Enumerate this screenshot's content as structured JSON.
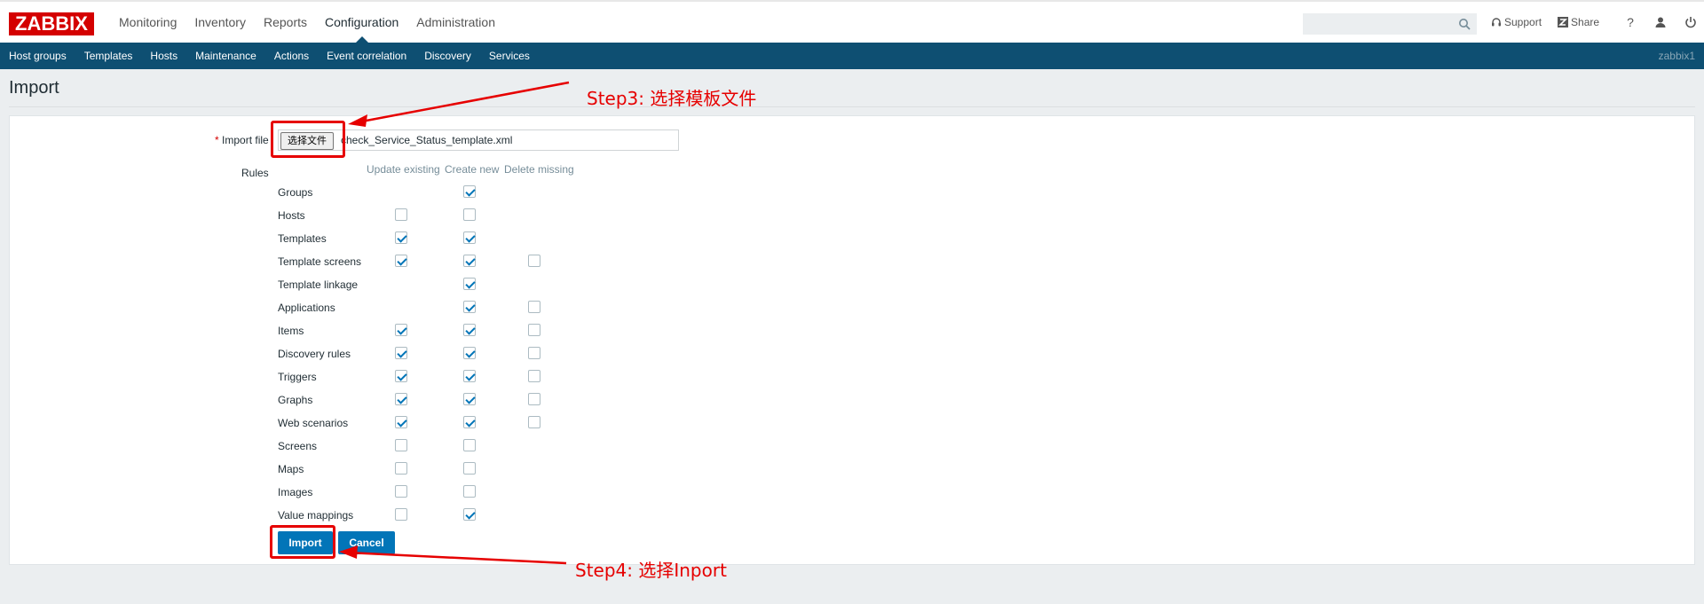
{
  "brand": {
    "logo_text": "ZABBIX",
    "logo_color": "#d40000"
  },
  "main_menu": [
    {
      "label": "Monitoring"
    },
    {
      "label": "Inventory"
    },
    {
      "label": "Reports"
    },
    {
      "label": "Configuration",
      "active": true
    },
    {
      "label": "Administration"
    }
  ],
  "search": {
    "placeholder": "",
    "value": ""
  },
  "top_right": {
    "support_label": "Support",
    "share_label": "Share",
    "help_label": "?"
  },
  "sub_menu": [
    {
      "label": "Host groups"
    },
    {
      "label": "Templates"
    },
    {
      "label": "Hosts"
    },
    {
      "label": "Maintenance"
    },
    {
      "label": "Actions"
    },
    {
      "label": "Event correlation"
    },
    {
      "label": "Discovery"
    },
    {
      "label": "Services"
    }
  ],
  "username": "zabbix1",
  "page": {
    "title": "Import"
  },
  "form": {
    "required_mark": "*",
    "import_file_label": "Import file",
    "choose_file_button": "选择文件",
    "file_name": "check_Service_Status_template.xml",
    "rules_label": "Rules",
    "columns": {
      "update_existing": "Update existing",
      "create_new": "Create new",
      "delete_missing": "Delete missing"
    },
    "rules": [
      {
        "name": "Groups",
        "update": null,
        "create": true,
        "delete": null
      },
      {
        "name": "Hosts",
        "update": false,
        "create": false,
        "delete": null
      },
      {
        "name": "Templates",
        "update": true,
        "create": true,
        "delete": null
      },
      {
        "name": "Template screens",
        "update": true,
        "create": true,
        "delete": false
      },
      {
        "name": "Template linkage",
        "update": null,
        "create": true,
        "delete": null
      },
      {
        "name": "Applications",
        "update": null,
        "create": true,
        "delete": false
      },
      {
        "name": "Items",
        "update": true,
        "create": true,
        "delete": false
      },
      {
        "name": "Discovery rules",
        "update": true,
        "create": true,
        "delete": false
      },
      {
        "name": "Triggers",
        "update": true,
        "create": true,
        "delete": false
      },
      {
        "name": "Graphs",
        "update": true,
        "create": true,
        "delete": false
      },
      {
        "name": "Web scenarios",
        "update": true,
        "create": true,
        "delete": false
      },
      {
        "name": "Screens",
        "update": false,
        "create": false,
        "delete": null
      },
      {
        "name": "Maps",
        "update": false,
        "create": false,
        "delete": null
      },
      {
        "name": "Images",
        "update": false,
        "create": false,
        "delete": null
      },
      {
        "name": "Value mappings",
        "update": false,
        "create": true,
        "delete": null
      }
    ],
    "import_button": "Import",
    "cancel_button": "Cancel"
  },
  "annotations": {
    "step3": "Step3: 选择模板文件",
    "step4": "Step4: 选择Inport",
    "color": "#e60000"
  },
  "colors": {
    "nav_bg": "#0e4f72",
    "button_bg": "#0275b8",
    "page_bg": "#ebeef0"
  }
}
